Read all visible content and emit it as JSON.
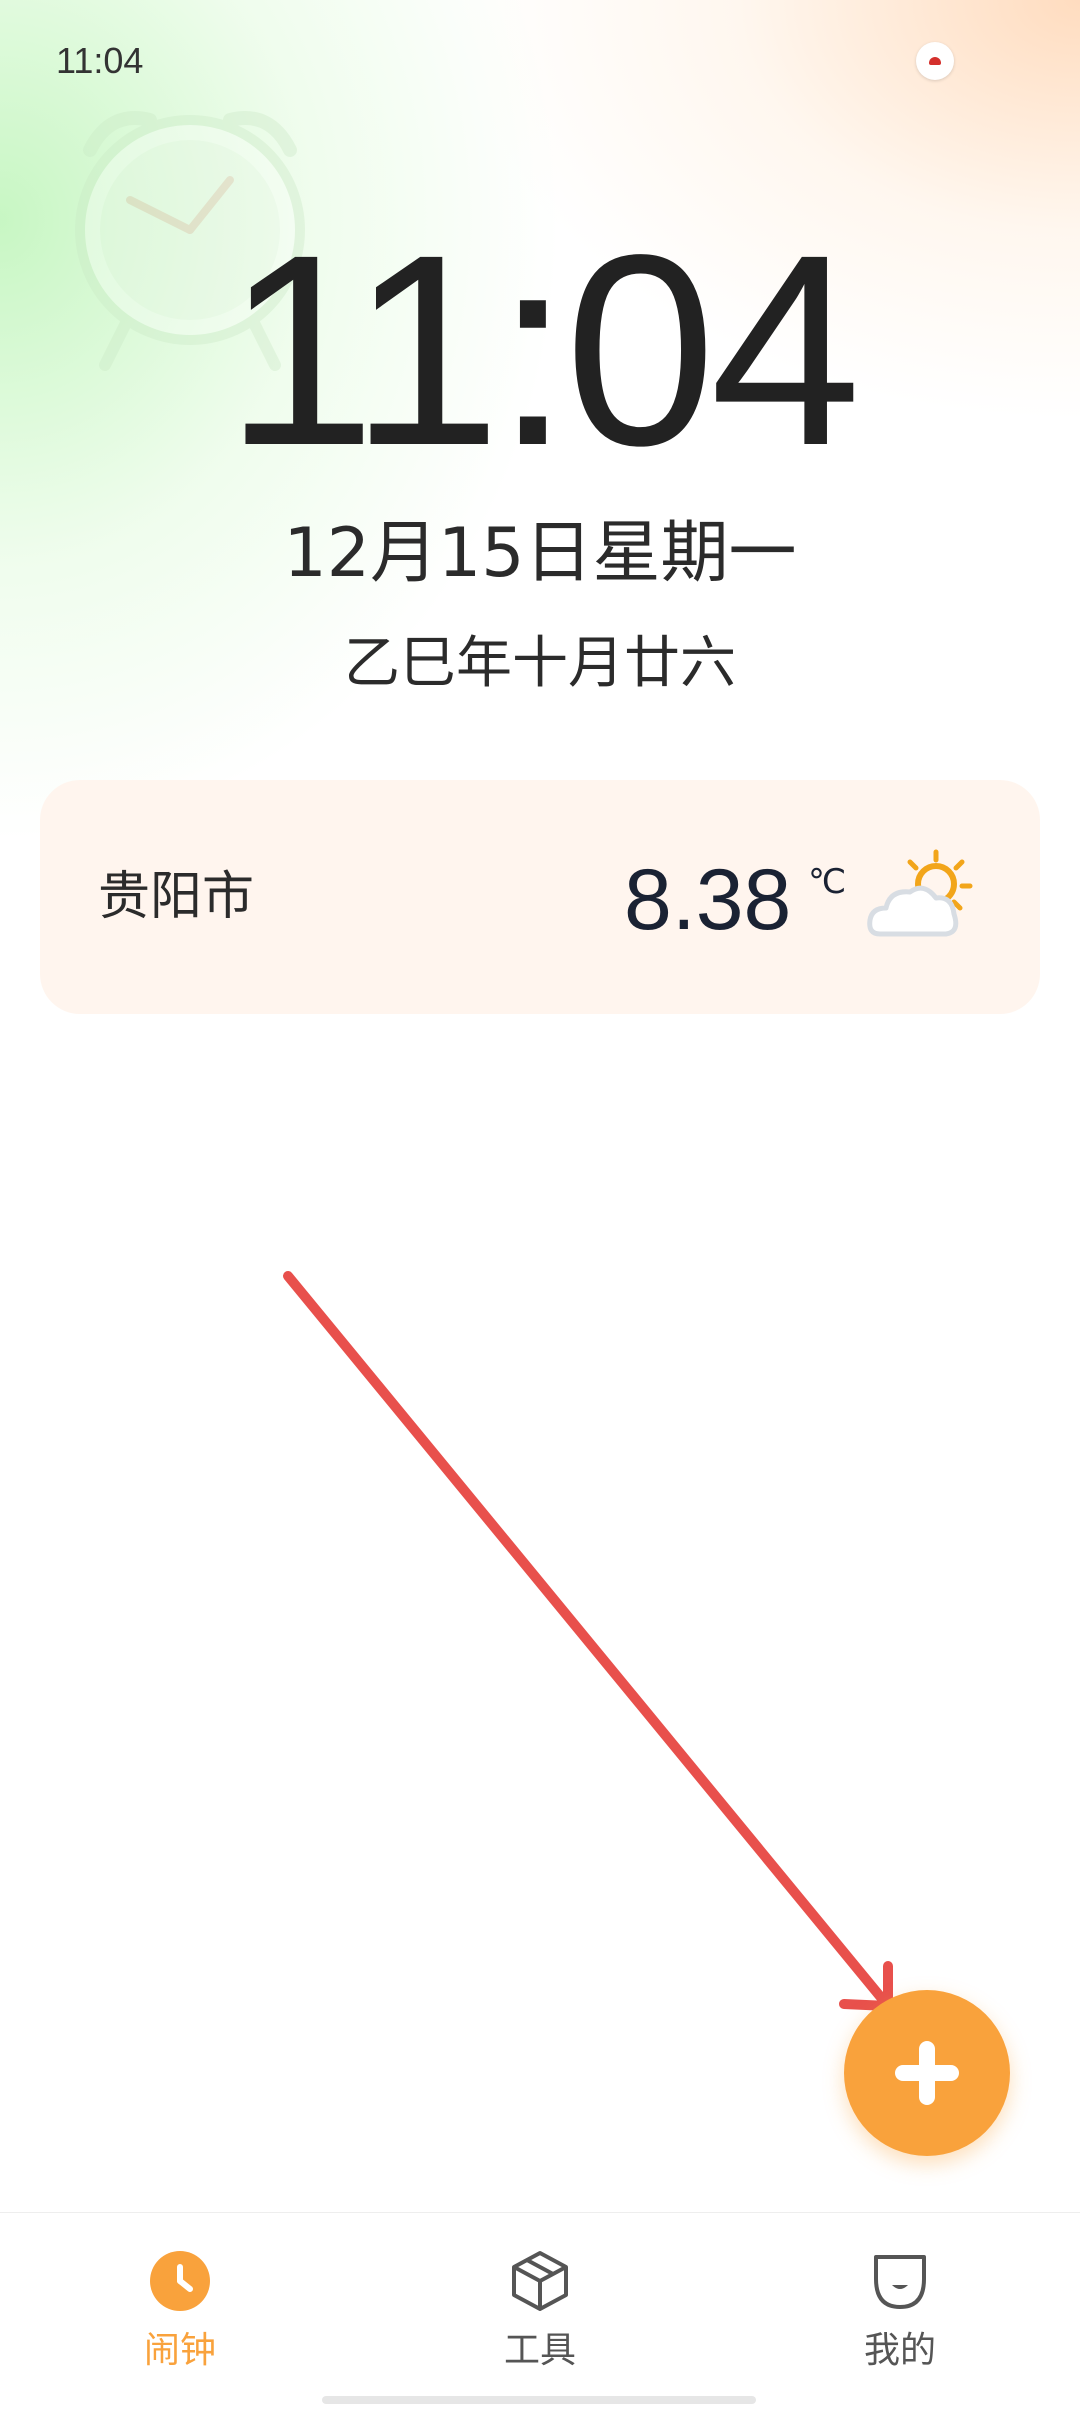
{
  "status_bar": {
    "time": "11:04"
  },
  "clock": {
    "time": "11:04",
    "date": "12月15日星期一",
    "lunar_date": "乙巳年十月廿六"
  },
  "weather": {
    "city": "贵阳市",
    "temperature": "8.38",
    "unit": "℃",
    "icon": "partly-cloudy-icon"
  },
  "fab": {
    "icon": "plus-icon"
  },
  "bottom_nav": {
    "items": [
      {
        "label": "闹钟",
        "icon": "alarm-clock-icon",
        "active": true
      },
      {
        "label": "工具",
        "icon": "toolbox-cube-icon",
        "active": false
      },
      {
        "label": "我的",
        "icon": "profile-face-icon",
        "active": false
      }
    ]
  },
  "colors": {
    "accent": "#f9a23c",
    "annotation_arrow": "#e8504c",
    "text_primary": "#222222",
    "nav_inactive": "#555555"
  }
}
